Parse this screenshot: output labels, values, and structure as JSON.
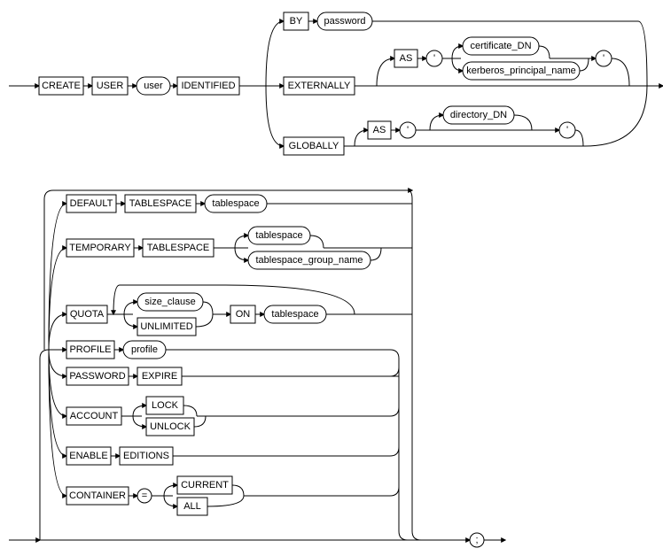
{
  "diagram": {
    "type": "railroad",
    "statement": "CREATE USER",
    "keywords": {
      "create": "CREATE",
      "user": "USER",
      "identified": "IDENTIFIED",
      "by": "BY",
      "externally": "EXTERNALLY",
      "globally": "GLOBALLY",
      "as": "AS",
      "default": "DEFAULT",
      "tablespace": "TABLESPACE",
      "tablespace2": "TABLESPACE",
      "temporary": "TEMPORARY",
      "quota": "QUOTA",
      "unlimited": "UNLIMITED",
      "on": "ON",
      "profile": "PROFILE",
      "password": "PASSWORD",
      "expire": "EXPIRE",
      "account": "ACCOUNT",
      "lock": "LOCK",
      "unlock": "UNLOCK",
      "enable": "ENABLE",
      "editions": "EDITIONS",
      "container": "CONTAINER",
      "current": "CURRENT",
      "all": "ALL"
    },
    "nonterminals": {
      "userv": "user",
      "passwordv": "password",
      "cert_dn": "certificate_DN",
      "kerb": "kerberos_principal_name",
      "dir_dn": "directory_DN",
      "tablespacev": "tablespace",
      "tablespacev2": "tablespace",
      "ts_group": "tablespace_group_name",
      "size_clause": "size_clause",
      "tablespacev3": "tablespace",
      "profilev": "profile"
    },
    "terminals": {
      "quote": "'",
      "equals": "=",
      "semicolon": ";"
    }
  }
}
